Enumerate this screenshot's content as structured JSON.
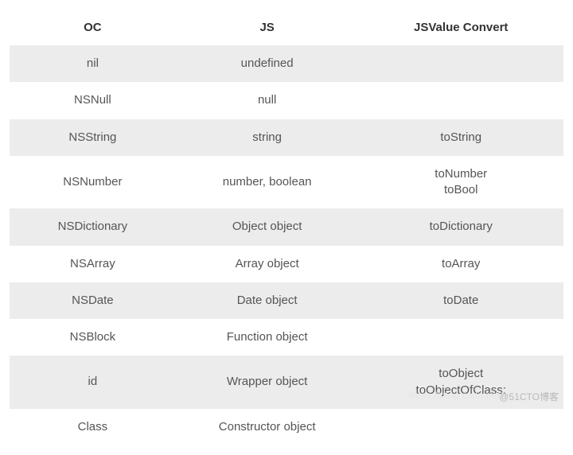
{
  "headers": {
    "c1": "OC",
    "c2": "JS",
    "c3": "JSValue Convert"
  },
  "rows": [
    {
      "c1": "nil",
      "c2": "undefined",
      "c3": ""
    },
    {
      "c1": "NSNull",
      "c2": "null",
      "c3": ""
    },
    {
      "c1": "NSString",
      "c2": "string",
      "c3": "toString"
    },
    {
      "c1": "NSNumber",
      "c2": "number, boolean",
      "c3a": "toNumber",
      "c3b": "toBool"
    },
    {
      "c1": "NSDictionary",
      "c2": "Object object",
      "c3": "toDictionary"
    },
    {
      "c1": "NSArray",
      "c2": "Array object",
      "c3": "toArray"
    },
    {
      "c1": "NSDate",
      "c2": "Date object",
      "c3": "toDate"
    },
    {
      "c1": "NSBlock",
      "c2": "Function object",
      "c3": ""
    },
    {
      "c1": "id",
      "c2": "Wrapper object",
      "c3a": "toObject",
      "c3b": "toObjectOfClass:"
    },
    {
      "c1": "Class",
      "c2": "Constructor object",
      "c3": ""
    }
  ],
  "watermark_faint": "https://blog.csdn.net/",
  "watermark": "@51CTO博客"
}
